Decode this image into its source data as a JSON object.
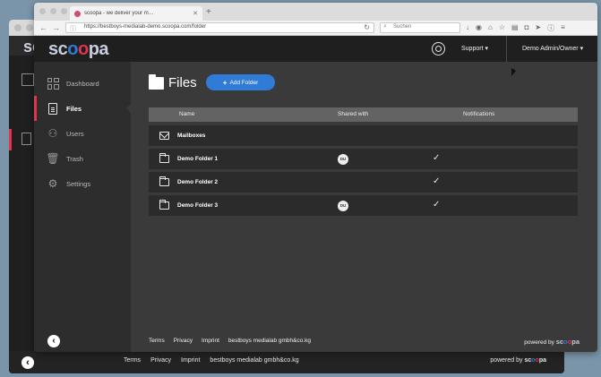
{
  "browser": {
    "tab_title": "scoopa - we deliver your m…",
    "url": "https://bestboys-medialab-demo.scoopa.com/folder",
    "search_placeholder": "Suchen"
  },
  "app": {
    "logo": {
      "pre": "sc",
      "o1": "o",
      "o2": "o",
      "post": "pa"
    },
    "header": {
      "support_label": "Support ▾",
      "user_label": "Demo Admin/Owner ▾"
    },
    "sidebar": {
      "items": [
        {
          "label": "Dashboard",
          "icon": "dashboard-icon"
        },
        {
          "label": "Files",
          "icon": "file-icon"
        },
        {
          "label": "Users",
          "icon": "users-icon"
        },
        {
          "label": "Trash",
          "icon": "trash-icon"
        },
        {
          "label": "Settings",
          "icon": "gear-icon"
        }
      ],
      "active_index": 1
    },
    "main": {
      "title": "Files",
      "add_folder_label": "Add Folder",
      "table": {
        "columns": [
          "Name",
          "Shared with",
          "Notifications"
        ],
        "rows": [
          {
            "name": "Mailboxes",
            "type": "mailbox",
            "shared": "",
            "notify": false
          },
          {
            "name": "Demo Folder 1",
            "type": "folder",
            "shared": "DU",
            "notify": true
          },
          {
            "name": "Demo Folder 2",
            "type": "folder",
            "shared": "",
            "notify": true
          },
          {
            "name": "Demo Folder 3",
            "type": "folder",
            "shared": "DU",
            "notify": true
          }
        ]
      }
    },
    "footer": {
      "links": [
        "Terms",
        "Privacy",
        "Imprint",
        "bestboys medialab gmbh&co.kg"
      ],
      "powered_by": "powered by"
    }
  },
  "colors": {
    "accent_blue": "#2f7bd6",
    "accent_red": "#e0344f",
    "bg_dark": "#1f1f20",
    "panel": "#3a3a3b"
  }
}
